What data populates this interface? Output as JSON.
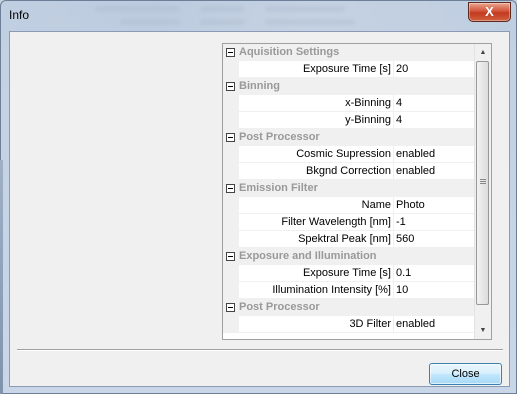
{
  "window": {
    "title": "Info",
    "close_glyph": "X"
  },
  "property_grid": {
    "sections": [
      {
        "category": "Aquisition Settings",
        "properties": [
          {
            "name": "Exposure Time [s]",
            "value": "20"
          }
        ]
      },
      {
        "category": "Binning",
        "properties": [
          {
            "name": "x-Binning",
            "value": "4"
          },
          {
            "name": "y-Binning",
            "value": "4"
          }
        ]
      },
      {
        "category": "Post Processor",
        "properties": [
          {
            "name": "Cosmic Supression",
            "value": "enabled"
          },
          {
            "name": "Bkgnd Correction",
            "value": "enabled"
          }
        ]
      },
      {
        "category": "Emission Filter",
        "properties": [
          {
            "name": "Name",
            "value": "Photo"
          },
          {
            "name": "Filter Wavelength [nm]",
            "value": "-1"
          },
          {
            "name": "Spektral Peak [nm]",
            "value": "560"
          }
        ]
      },
      {
        "category": "Exposure and Illumination",
        "properties": [
          {
            "name": "Exposure Time [s]",
            "value": "0.1"
          },
          {
            "name": "Illumination Intensity [%]",
            "value": "10"
          }
        ]
      },
      {
        "category": "Post Processor",
        "properties": [
          {
            "name": "3D Filter",
            "value": "enabled"
          }
        ]
      }
    ]
  },
  "footer": {
    "close_label": "Close"
  },
  "icons": {
    "scroll_up": "scroll-up-arrow-icon",
    "scroll_down": "scroll-down-arrow-icon",
    "collapse": "collapse-minus-icon"
  }
}
